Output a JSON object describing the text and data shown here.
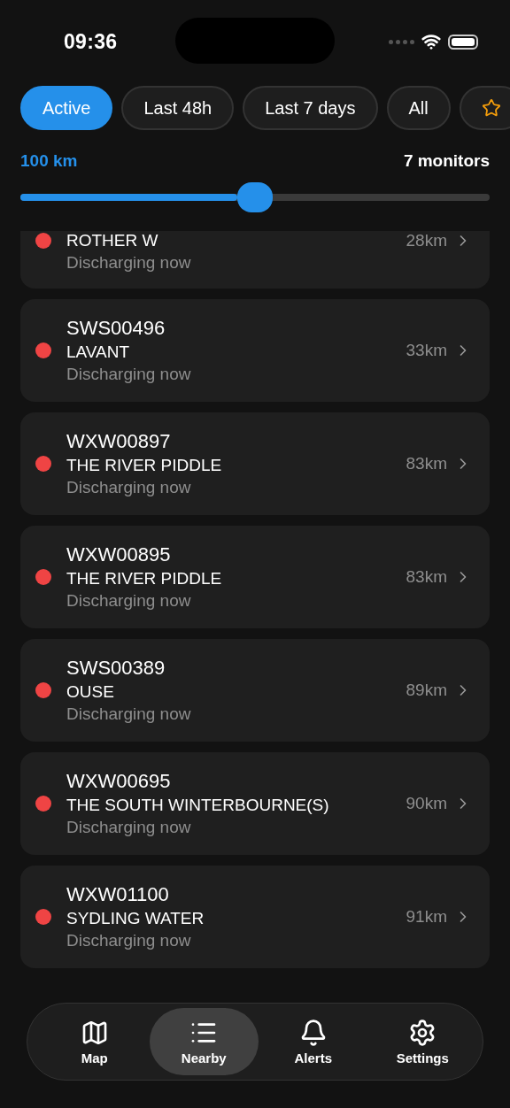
{
  "status_bar": {
    "time": "09:36"
  },
  "filters": [
    {
      "kind": "text",
      "label": "Active",
      "selected": true
    },
    {
      "kind": "text",
      "label": "Last 48h",
      "selected": false
    },
    {
      "kind": "text",
      "label": "Last 7 days",
      "selected": false
    },
    {
      "kind": "text",
      "label": "All",
      "selected": false
    },
    {
      "kind": "star",
      "selected": false
    }
  ],
  "radius": {
    "label": "100 km",
    "count": "7 monitors",
    "level": 0.5
  },
  "monitors": [
    {
      "name": "ROTHER W",
      "status": "Discharging now",
      "distance": "28km",
      "color": "#ef4444"
    },
    {
      "code": "SWS00496",
      "name": "LAVANT",
      "status": "Discharging now",
      "distance": "33km",
      "color": "#ef4444"
    },
    {
      "code": "WXW00897",
      "name": "THE RIVER PIDDLE",
      "status": "Discharging now",
      "distance": "83km",
      "color": "#ef4444"
    },
    {
      "code": "WXW00895",
      "name": "THE RIVER PIDDLE",
      "status": "Discharging now",
      "distance": "83km",
      "color": "#ef4444"
    },
    {
      "code": "SWS00389",
      "name": "OUSE",
      "status": "Discharging now",
      "distance": "89km",
      "color": "#ef4444"
    },
    {
      "code": "WXW00695",
      "name": "THE SOUTH WINTERBOURNE(S)",
      "status": "Discharging now",
      "distance": "90km",
      "color": "#ef4444"
    },
    {
      "code": "WXW01100",
      "name": "SYDLING WATER",
      "status": "Discharging now",
      "distance": "91km",
      "color": "#ef4444"
    }
  ],
  "tab_bar": [
    {
      "kind": "map",
      "label": "Map",
      "selected": false
    },
    {
      "kind": "list",
      "label": "Nearby",
      "selected": true
    },
    {
      "kind": "bell",
      "label": "Alerts",
      "selected": false
    },
    {
      "kind": "gear",
      "label": "Settings",
      "selected": false
    }
  ]
}
